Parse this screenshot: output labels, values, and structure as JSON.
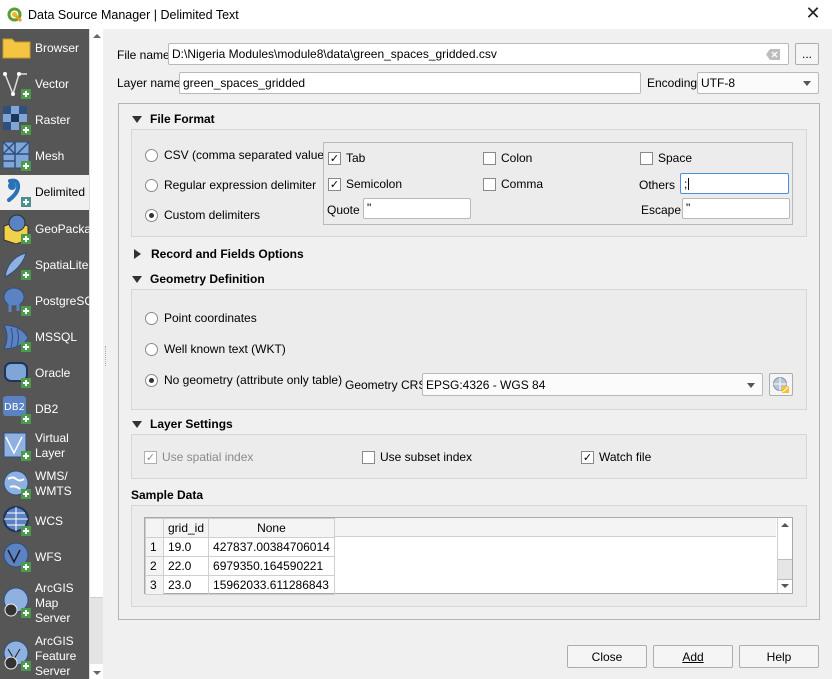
{
  "window": {
    "title": "Data Source Manager | Delimited Text",
    "close_glyph": "✕"
  },
  "sidebar": {
    "items": [
      {
        "label": "Browser",
        "icon": "folder-icon"
      },
      {
        "label": "Vector",
        "icon": "vector-icon"
      },
      {
        "label": "Raster",
        "icon": "raster-icon"
      },
      {
        "label": "Mesh",
        "icon": "mesh-icon"
      },
      {
        "label": "Delimited",
        "icon": "delimited-text-icon",
        "active": true
      },
      {
        "label": "GeoPackage",
        "icon": "geopackage-icon"
      },
      {
        "label": "SpatiaLite",
        "icon": "spatialite-icon"
      },
      {
        "label": "PostgreSQL",
        "icon": "postgresql-icon"
      },
      {
        "label": "MSSQL",
        "icon": "mssql-icon"
      },
      {
        "label": "Oracle",
        "icon": "oracle-icon"
      },
      {
        "label": "DB2",
        "icon": "db2-icon"
      },
      {
        "label": "Virtual Layer",
        "icon": "virtual-layer-icon"
      },
      {
        "label": "WMS/ WMTS",
        "icon": "wms-icon"
      },
      {
        "label": "WCS",
        "icon": "wcs-icon"
      },
      {
        "label": "WFS",
        "icon": "wfs-icon"
      },
      {
        "label": "ArcGIS Map Server",
        "icon": "arcgis-map-server-icon"
      },
      {
        "label": "ArcGIS Feature Server",
        "icon": "arcgis-feature-server-icon"
      }
    ],
    "labels": {
      "browser": "Browser",
      "vector": "Vector",
      "raster": "Raster",
      "mesh": "Mesh",
      "delimited": "Delimited",
      "geopackage": "GeoPackage",
      "spatialite": "SpatiaLite",
      "postgresql": "PostgreSQL",
      "mssql": "MSSQL",
      "oracle": "Oracle",
      "db2": "DB2",
      "db2_badge": "DB2",
      "virtual_1": "Virtual",
      "virtual_2": "Layer",
      "wms_1": "WMS/",
      "wms_2": "WMTS",
      "wcs": "WCS",
      "wfs": "WFS",
      "arcmap_1": "ArcGIS",
      "arcmap_2": "Map",
      "arcmap_3": "Server",
      "arcfeat_1": "ArcGIS",
      "arcfeat_2": "Feature",
      "arcfeat_3": "Server"
    }
  },
  "form": {
    "file_name_label": "File name",
    "file_name_value": "D:\\Nigeria Modules\\module8\\data\\green_spaces_gridded.csv",
    "browse_label": "...",
    "layer_name_label": "Layer name",
    "layer_name_value": "green_spaces_gridded",
    "encoding_label": "Encoding",
    "encoding_value": "UTF-8"
  },
  "file_format": {
    "title": "File Format",
    "expanded": true,
    "options": {
      "csv": "CSV (comma separated values)",
      "regex": "Regular expression delimiter",
      "custom": "Custom delimiters"
    },
    "selected": "custom",
    "delimiters": {
      "tab": {
        "label": "Tab",
        "checked": true
      },
      "semicolon": {
        "label": "Semicolon",
        "checked": true
      },
      "colon": {
        "label": "Colon",
        "checked": false
      },
      "comma": {
        "label": "Comma",
        "checked": false
      },
      "space": {
        "label": "Space",
        "checked": false
      }
    },
    "others_label": "Others",
    "others_value": ";",
    "quote_label": "Quote",
    "quote_value": "\"",
    "escape_label": "Escape",
    "escape_value": "\""
  },
  "record_fields": {
    "title": "Record and Fields Options",
    "expanded": false
  },
  "geometry": {
    "title": "Geometry Definition",
    "expanded": true,
    "options": {
      "point": "Point coordinates",
      "wkt": "Well known text (WKT)",
      "none": "No geometry (attribute only table)"
    },
    "selected": "none",
    "crs_label": "Geometry CRS",
    "crs_value": "EPSG:4326 - WGS 84"
  },
  "layer_settings": {
    "title": "Layer Settings",
    "expanded": true,
    "spatial_index": {
      "label": "Use spatial index",
      "checked": true,
      "disabled": true
    },
    "subset_index": {
      "label": "Use subset index",
      "checked": false
    },
    "watch_file": {
      "label": "Watch file",
      "checked": true
    }
  },
  "sample_data": {
    "title": "Sample Data",
    "columns": [
      "",
      "grid_id",
      "None"
    ],
    "rows": [
      [
        "1",
        "19.0",
        "427837.00384706014"
      ],
      [
        "2",
        "22.0",
        "6979350.164590221"
      ],
      [
        "3",
        "23.0",
        "15962033.611286843"
      ]
    ]
  },
  "buttons": {
    "close": "Close",
    "add": "Add",
    "help": "Help"
  },
  "glyphs": {
    "check": "✓"
  }
}
